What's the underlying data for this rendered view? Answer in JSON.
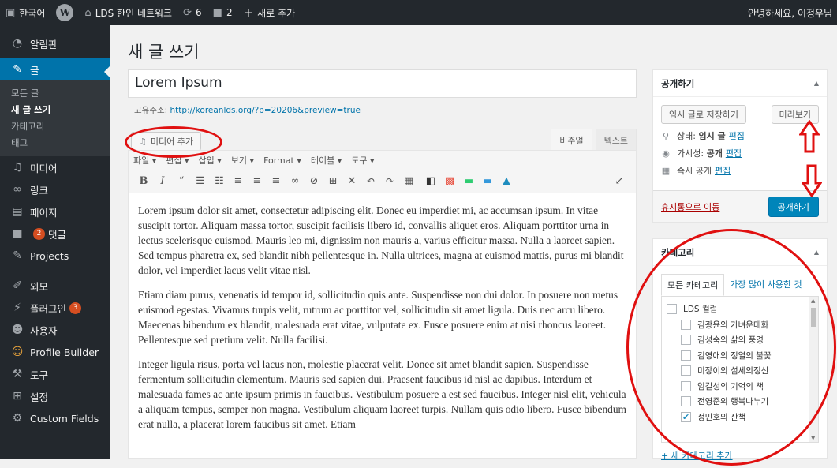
{
  "adminbar": {
    "language": "한국어",
    "language_icon": "flag-icon",
    "site_name": "LDS 한인 네트워크",
    "updates_count": "6",
    "comments_count": "2",
    "new_label": "새로 추가",
    "greeting": "안녕하세요, 이정우님"
  },
  "sidebar": {
    "dashboard": "알림판",
    "posts": "글",
    "posts_sub": [
      "모든 글",
      "새 글 쓰기",
      "카테고리",
      "태그"
    ],
    "media": "미디어",
    "links": "링크",
    "pages": "페이지",
    "comments": "댓글",
    "comments_badge": "2",
    "projects": "Projects",
    "appearance": "외모",
    "plugins": "플러그인",
    "plugins_badge": "3",
    "users": "사용자",
    "profile_builder": "Profile Builder",
    "tools": "도구",
    "settings": "설정",
    "custom_fields": "Custom Fields"
  },
  "main": {
    "page_title": "새 글 쓰기",
    "post_title": "Lorem Ipsum",
    "permalink_label": "고유주소:",
    "permalink_url": "http://koreanlds.org/?p=20206&preview=true",
    "media_button": "미디어 추가",
    "tab_visual": "비주얼",
    "tab_text": "텍스트",
    "menubar": [
      "파일 ▾",
      "편집 ▾",
      "삽입 ▾",
      "보기 ▾",
      "Format ▾",
      "테이블 ▾",
      "도구 ▾"
    ],
    "paragraphs": [
      "Lorem ipsum dolor sit amet, consectetur adipiscing elit. Donec eu imperdiet mi, ac accumsan ipsum. In vitae suscipit tortor. Aliquam massa tortor, suscipit facilisis libero id, convallis aliquet eros. Aliquam porttitor urna in lectus scelerisque euismod. Mauris leo mi, dignissim non mauris a, varius efficitur massa. Nulla a laoreet sapien. Sed tempus pharetra ex, sed blandit nibh pellentesque in. Nulla ultrices, magna at euismod mattis, purus mi blandit dolor, vel imperdiet lacus velit vitae nisl.",
      "Etiam diam purus, venenatis id tempor id, sollicitudin quis ante. Suspendisse non dui dolor. In posuere non metus euismod egestas. Vivamus turpis velit, rutrum ac porttitor vel, sollicitudin sit amet ligula. Duis nec arcu libero. Maecenas bibendum ex blandit, malesuada erat vitae, vulputate ex. Fusce posuere enim at nisi rhoncus laoreet. Pellentesque sed pretium velit. Nulla facilisi.",
      "Integer ligula risus, porta vel lacus non, molestie placerat velit. Donec sit amet blandit sapien. Suspendisse fermentum sollicitudin elementum. Mauris sed sapien dui. Praesent faucibus id nisl ac dapibus. Interdum et malesuada fames ac ante ipsum primis in faucibus. Vestibulum posuere a est sed faucibus. Integer nisl elit, vehicula a aliquam tempus, semper non magna. Vestibulum aliquam laoreet turpis. Nullam quis odio libero. Fusce bibendum erat nulla, a placerat lorem faucibus sit amet. Etiam"
    ]
  },
  "publish": {
    "title": "공개하기",
    "save_draft": "임시 글로 저장하기",
    "preview": "미리보기",
    "status_label": "상태:",
    "status_value": "임시 글",
    "visibility_label": "가시성:",
    "visibility_value": "공개",
    "schedule_label": "즉시 공개",
    "edit_link": "편집",
    "trash": "휴지통으로 이동",
    "publish_button": "공개하기"
  },
  "categories": {
    "title": "카테고리",
    "tab_all": "모든 카테고리",
    "tab_popular": "가장 많이 사용한 것",
    "items": [
      {
        "label": "LDS 컬럼",
        "checked": false,
        "child": false
      },
      {
        "label": "김광윤의 가벼운대화",
        "checked": false,
        "child": true
      },
      {
        "label": "김성숙의 삶의 풍경",
        "checked": false,
        "child": true
      },
      {
        "label": "김영애의 정열의 불꽃",
        "checked": false,
        "child": true
      },
      {
        "label": "미장이의 섬세의정신",
        "checked": false,
        "child": true
      },
      {
        "label": "임길성의 기억의 책",
        "checked": false,
        "child": true
      },
      {
        "label": "전영준의 행복나누기",
        "checked": false,
        "child": true
      },
      {
        "label": "정민호의 산책",
        "checked": true,
        "child": true
      }
    ],
    "add_new": "+ 새 카테고리 추가"
  },
  "colors": {
    "accent": "#0073aa",
    "annotation": "#e01010",
    "adminbar": "#23282d"
  }
}
